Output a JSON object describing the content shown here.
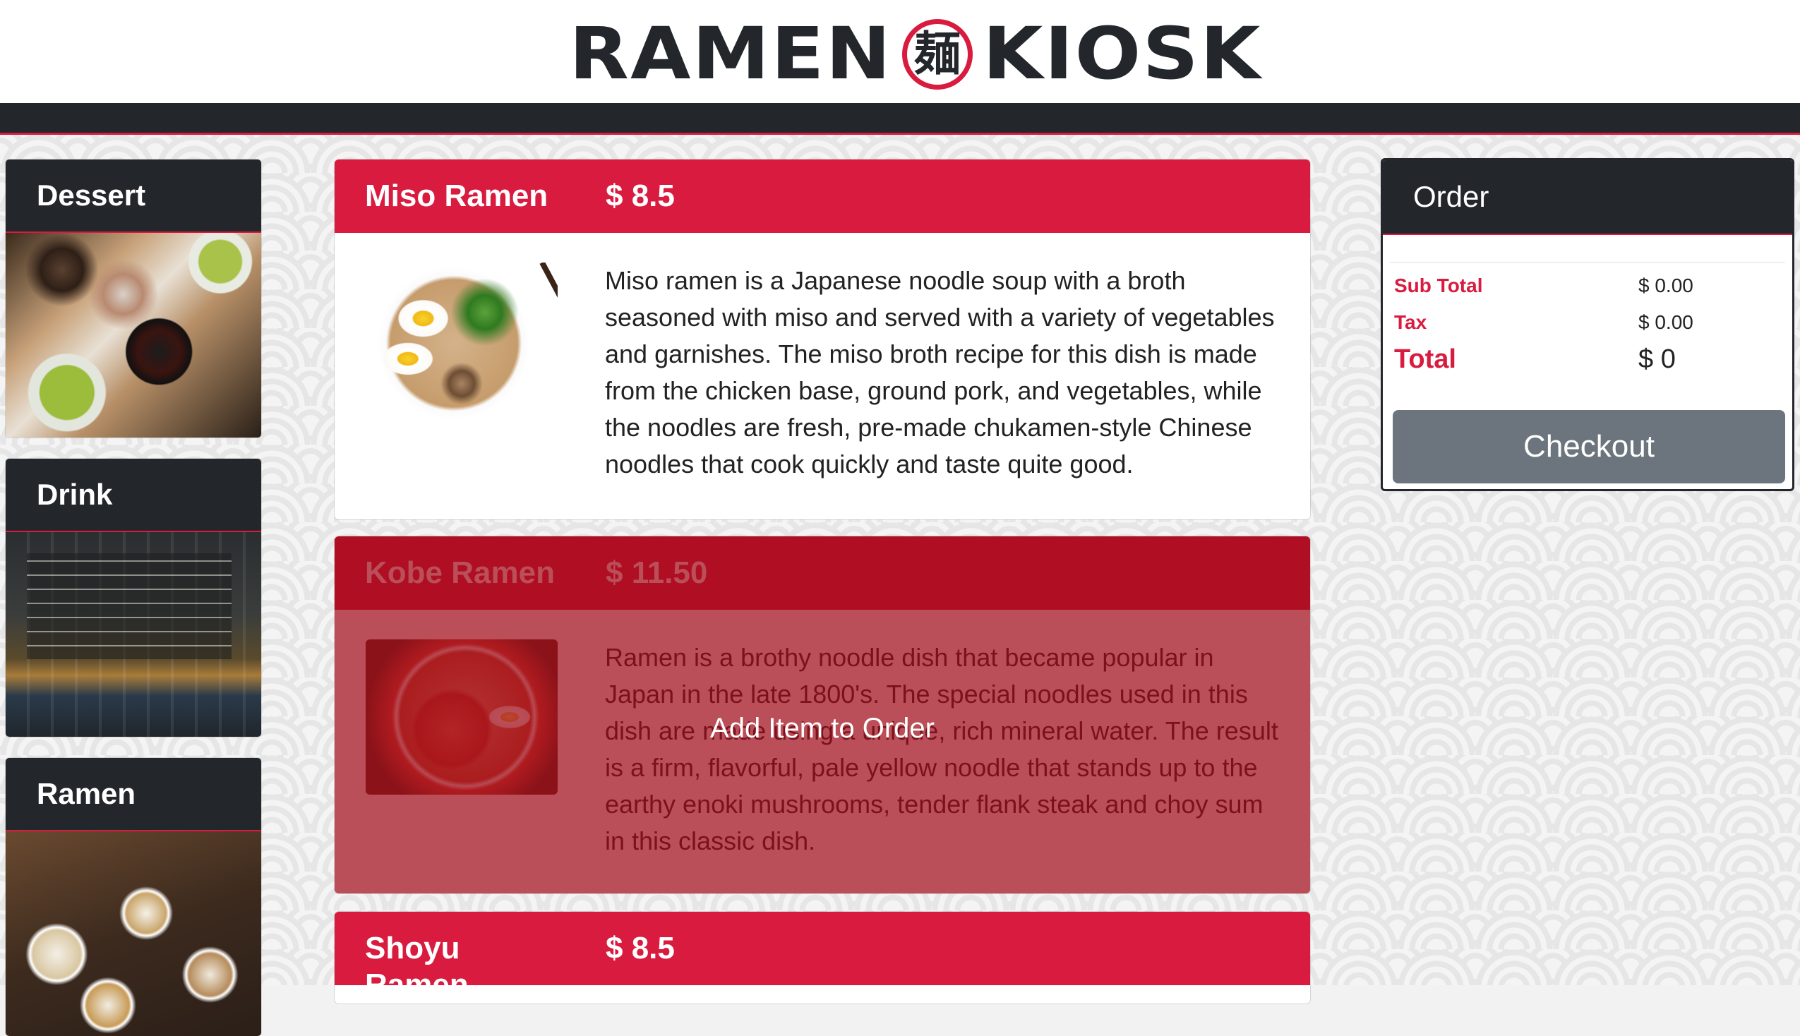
{
  "header": {
    "logo_left": "RAMEN",
    "logo_mark": "麺",
    "logo_right": "KIOSK"
  },
  "categories": [
    {
      "label": "Dessert"
    },
    {
      "label": "Drink"
    },
    {
      "label": "Ramen"
    }
  ],
  "menu": [
    {
      "name": "Miso Ramen",
      "price": "$ 8.5",
      "description": "Miso ramen is a Japanese noodle soup with a broth seasoned with miso and served with a variety of vegetables and garnishes. The miso broth recipe for this dish is made from the chicken base, ground pork, and vegetables, while the noodles are fresh, pre-made chukamen-style Chinese noodles that cook quickly and taste quite good."
    },
    {
      "name": "Kobe Ramen",
      "price": "$ 11.50",
      "description": "Ramen is a brothy noodle dish that became popular in Japan in the late 1800's. The special noodles used in this dish are made using a unique, rich mineral water. The result is a firm, flavorful, pale yellow noodle that stands up to the earthy enoki mushrooms, tender flank steak and choy sum in this classic dish.",
      "overlay_label": "Add Item to Order"
    },
    {
      "name": "Shoyu Ramen",
      "price": "$ 8.5"
    }
  ],
  "order": {
    "title": "Order",
    "subtotal_label": "Sub Total",
    "subtotal_value": "$ 0.00",
    "tax_label": "Tax",
    "tax_value": "$ 0.00",
    "total_label": "Total",
    "total_value": "$ 0",
    "checkout_label": "Checkout"
  },
  "colors": {
    "brand_red": "#d81b3f",
    "dark": "#23262b",
    "button_gray": "#6c757d"
  }
}
